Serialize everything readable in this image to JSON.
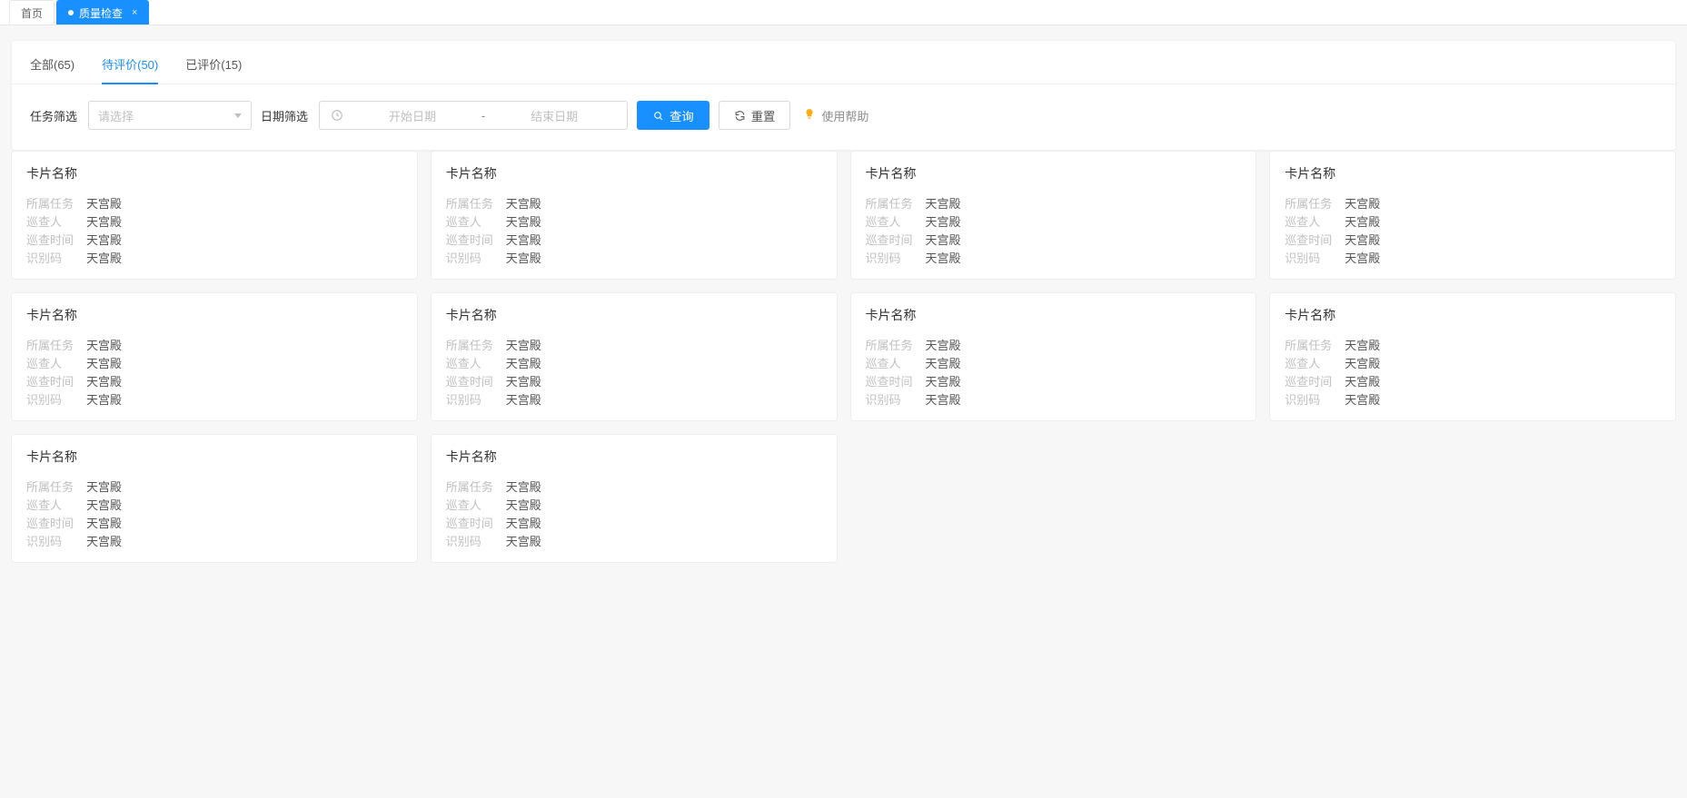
{
  "page_tabs": [
    {
      "label": "首页",
      "active": false,
      "closable": false
    },
    {
      "label": "质量检查",
      "active": true,
      "closable": true
    }
  ],
  "inner_tabs": [
    {
      "id": "all",
      "label": "全部(65)",
      "active": false
    },
    {
      "id": "pending",
      "label": "待评价(50)",
      "active": true
    },
    {
      "id": "done",
      "label": "已评价(15)",
      "active": false
    }
  ],
  "filters": {
    "task_label": "任务筛选",
    "task_placeholder": "请选择",
    "date_label": "日期筛选",
    "start_placeholder": "开始日期",
    "end_placeholder": "结束日期",
    "range_separator": "-",
    "search_btn": "查询",
    "reset_btn": "重置",
    "help_label": "使用帮助"
  },
  "card_field_labels": {
    "task": "所属任务",
    "inspector": "巡查人",
    "time": "巡查时间",
    "code": "识别码"
  },
  "cards": [
    {
      "title": "卡片名称",
      "task": "天宫殿",
      "inspector": "天宫殿",
      "time": "天宫殿",
      "code": "天宫殿"
    },
    {
      "title": "卡片名称",
      "task": "天宫殿",
      "inspector": "天宫殿",
      "time": "天宫殿",
      "code": "天宫殿"
    },
    {
      "title": "卡片名称",
      "task": "天宫殿",
      "inspector": "天宫殿",
      "time": "天宫殿",
      "code": "天宫殿"
    },
    {
      "title": "卡片名称",
      "task": "天宫殿",
      "inspector": "天宫殿",
      "time": "天宫殿",
      "code": "天宫殿"
    },
    {
      "title": "卡片名称",
      "task": "天宫殿",
      "inspector": "天宫殿",
      "time": "天宫殿",
      "code": "天宫殿"
    },
    {
      "title": "卡片名称",
      "task": "天宫殿",
      "inspector": "天宫殿",
      "time": "天宫殿",
      "code": "天宫殿"
    },
    {
      "title": "卡片名称",
      "task": "天宫殿",
      "inspector": "天宫殿",
      "time": "天宫殿",
      "code": "天宫殿"
    },
    {
      "title": "卡片名称",
      "task": "天宫殿",
      "inspector": "天宫殿",
      "time": "天宫殿",
      "code": "天宫殿"
    },
    {
      "title": "卡片名称",
      "task": "天宫殿",
      "inspector": "天宫殿",
      "time": "天宫殿",
      "code": "天宫殿"
    },
    {
      "title": "卡片名称",
      "task": "天宫殿",
      "inspector": "天宫殿",
      "time": "天宫殿",
      "code": "天宫殿"
    }
  ]
}
